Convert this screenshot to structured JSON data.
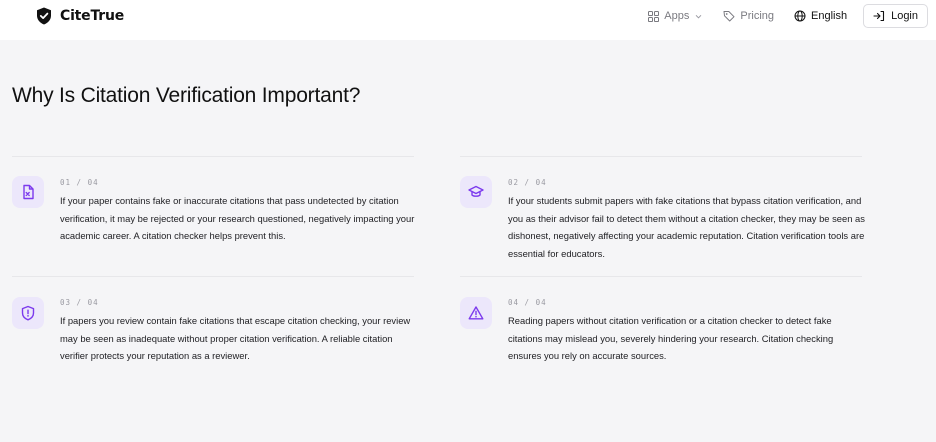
{
  "header": {
    "brand": "CiteTrue",
    "nav": {
      "apps": "Apps",
      "pricing": "Pricing",
      "language": "English",
      "login": "Login"
    }
  },
  "main": {
    "title": "Why Is Citation Verification Important?",
    "cards": [
      {
        "number": "01 / 04",
        "icon": "file-x-icon",
        "text": "If your paper contains fake or inaccurate citations that pass undetected by citation verification, it may be rejected or your research questioned, negatively impacting your academic career. A citation checker helps prevent this."
      },
      {
        "number": "02 / 04",
        "icon": "graduation-cap-icon",
        "text": "If your students submit papers with fake citations that bypass citation verification, and you as their advisor fail to detect them without a citation checker, they may be seen as dishonest, negatively affecting your academic reputation. Citation verification tools are essential for educators."
      },
      {
        "number": "03 / 04",
        "icon": "shield-alert-icon",
        "text": "If papers you review contain fake citations that escape citation checking, your review may be seen as inadequate without proper citation verification. A reliable citation verifier protects your reputation as a reviewer."
      },
      {
        "number": "04 / 04",
        "icon": "warning-triangle-icon",
        "text": "Reading papers without citation verification or a citation checker to detect fake citations may mislead you, severely hindering your research. Citation checking ensures you rely on accurate sources."
      }
    ]
  },
  "colors": {
    "accent": "#7c3aed",
    "icon_bg": "#ece7fb",
    "page_bg": "#f5f5f7"
  }
}
